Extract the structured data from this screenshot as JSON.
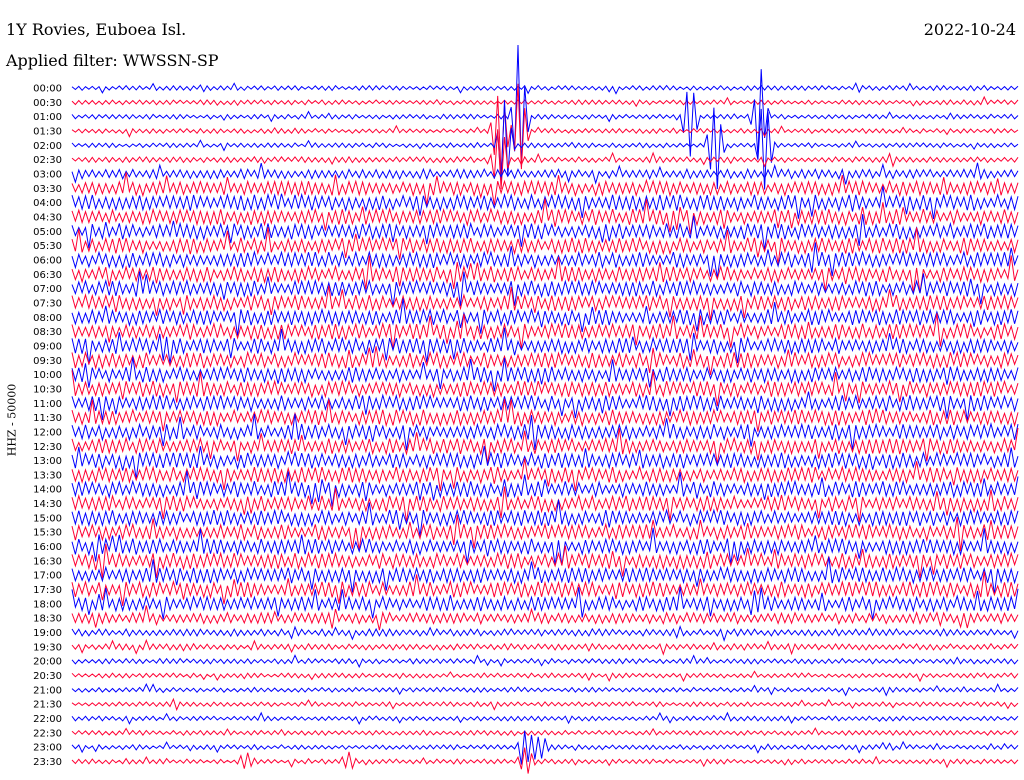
{
  "header": {
    "station": "1Y Rovies, Euboea Isl.",
    "date": "2022-10-24",
    "filter": "Applied filter: WWSSN-SP"
  },
  "channel_label": "HHZ - 50000",
  "chart_data": {
    "type": "line",
    "title": "1Y Rovies, Euboea Isl.",
    "subtitle": "Applied filter: WWSSN-SP",
    "ylabel": "HHZ - 50000",
    "xlabel": "",
    "row_labels": [
      "00:00",
      "00:30",
      "01:00",
      "01:30",
      "02:00",
      "02:30",
      "03:00",
      "03:30",
      "04:00",
      "04:30",
      "05:00",
      "05:30",
      "06:00",
      "06:30",
      "07:00",
      "07:30",
      "08:00",
      "08:30",
      "09:00",
      "09:30",
      "10:00",
      "10:30",
      "11:00",
      "11:30",
      "12:00",
      "12:30",
      "13:00",
      "13:30",
      "14:00",
      "14:30",
      "15:00",
      "15:30",
      "16:00",
      "16:30",
      "17:00",
      "17:30",
      "18:00",
      "18:30",
      "19:00",
      "19:30",
      "20:00",
      "20:30",
      "21:00",
      "21:30",
      "22:00",
      "22:30",
      "23:00",
      "23:30"
    ],
    "row_colors": [
      "#0000ff",
      "#ff0033"
    ],
    "relative_noise_amplitude": [
      1,
      1,
      1,
      1,
      1,
      1.2,
      2,
      3,
      3.3,
      3.3,
      3.3,
      3.3,
      3.3,
      3.3,
      3.3,
      3.3,
      3.3,
      3.3,
      3.3,
      3.3,
      3.3,
      3.3,
      3.3,
      3.3,
      3.3,
      3.3,
      3.3,
      3.3,
      3.3,
      3.3,
      3.3,
      3.3,
      3.3,
      3.3,
      3.3,
      3.3,
      3,
      2.3,
      1.5,
      1.3,
      1.1,
      1,
      1,
      1,
      1,
      1,
      1,
      1
    ],
    "grid": false,
    "legend": "none"
  }
}
